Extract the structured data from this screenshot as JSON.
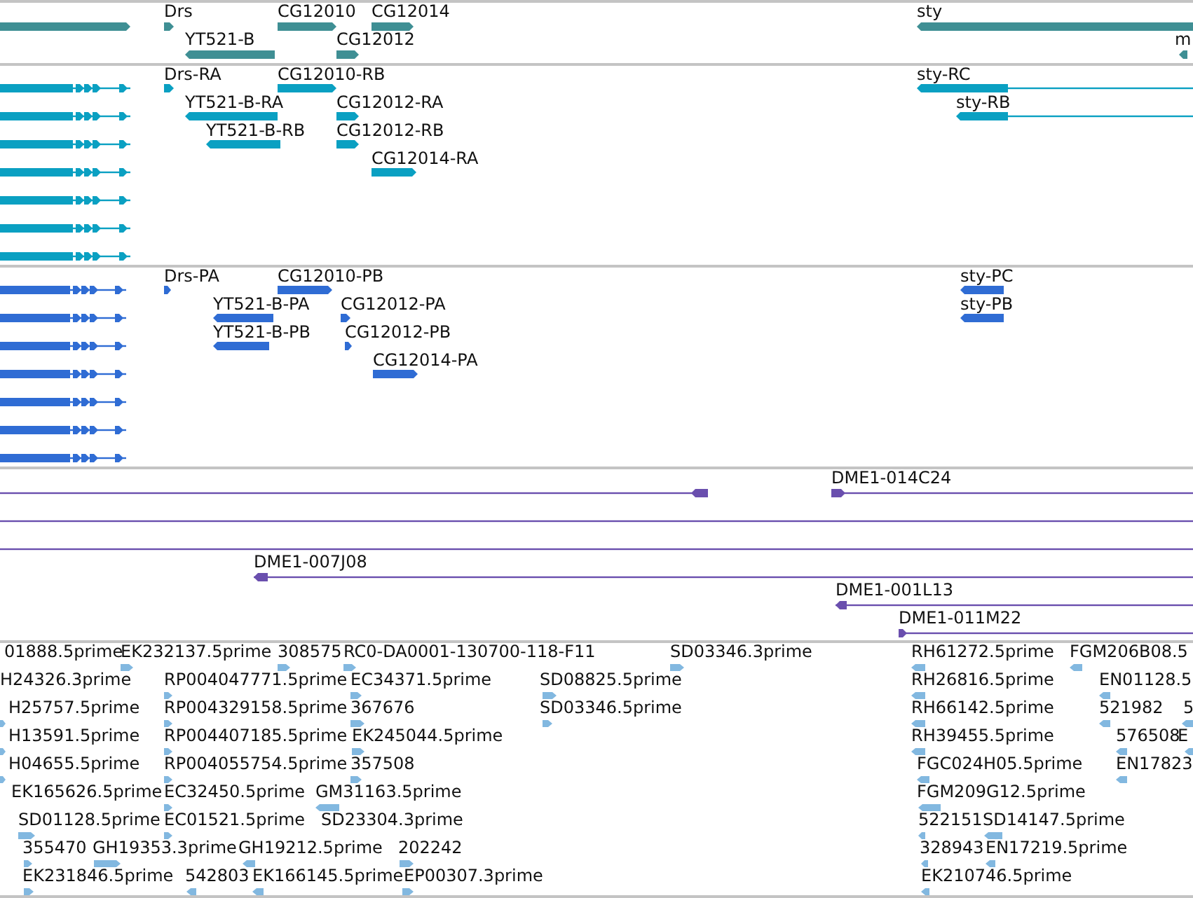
{
  "tracks": [
    {
      "kind": "gene",
      "features": [
        {
          "reverse": false
        },
        {
          "label": "Drs",
          "reverse": false
        },
        {
          "label": "CG12010",
          "reverse": false
        },
        {
          "label": "CG12014",
          "reverse": false
        },
        {
          "label": "sty",
          "reverse": true
        },
        {
          "label": "YT521-B",
          "reverse": true
        },
        {
          "label": "CG12012",
          "reverse": false
        },
        {
          "label": "m",
          "reverse": true
        }
      ]
    },
    {
      "kind": "transcript",
      "features": [
        {
          "reverse": false
        },
        {
          "label": "Drs-RA",
          "reverse": false
        },
        {
          "label": "CG12010-RB",
          "reverse": false
        },
        {
          "label": "sty-RC",
          "reverse": true
        },
        {
          "reverse": false
        },
        {
          "label": "YT521-B-RA",
          "reverse": true
        },
        {
          "label": "CG12012-RA",
          "reverse": false
        },
        {
          "label": "sty-RB",
          "reverse": true
        },
        {
          "reverse": false
        },
        {
          "label": "YT521-B-RB",
          "reverse": true
        },
        {
          "label": "CG12012-RB",
          "reverse": false
        },
        {
          "reverse": false
        },
        {
          "label": "CG12014-RA",
          "reverse": false
        },
        {
          "reverse": false
        },
        {
          "reverse": false
        },
        {
          "reverse": false
        }
      ]
    },
    {
      "kind": "protein",
      "features": [
        {
          "reverse": false
        },
        {
          "label": "Drs-PA",
          "reverse": false
        },
        {
          "label": "CG12010-PB",
          "reverse": false
        },
        {
          "label": "sty-PC",
          "reverse": true
        },
        {
          "reverse": false
        },
        {
          "label": "YT521-B-PA",
          "reverse": true
        },
        {
          "label": "CG12012-PA",
          "reverse": false
        },
        {
          "label": "sty-PB",
          "reverse": true
        },
        {
          "reverse": false
        },
        {
          "label": "YT521-B-PB",
          "reverse": true
        },
        {
          "label": "CG12012-PB",
          "reverse": false
        },
        {
          "reverse": false
        },
        {
          "label": "CG12014-PA",
          "reverse": false
        },
        {
          "reverse": false
        },
        {
          "reverse": false
        },
        {
          "reverse": false
        }
      ]
    },
    {
      "kind": "clone",
      "features": [
        {
          "reverse": true
        },
        {
          "label": "DME1-014C24",
          "reverse": false
        },
        {
          "kind": "line"
        },
        {
          "kind": "line"
        },
        {
          "label": "DME1-007J08",
          "reverse": true
        },
        {
          "label": "DME1-001L13",
          "reverse": true
        },
        {
          "label": "DME1-011M22",
          "reverse": false
        }
      ]
    },
    {
      "kind": "est",
      "features": [
        {
          "label": "01888.5prime"
        },
        {
          "label": "EK232137.5prime",
          "reverse": false
        },
        {
          "label": "308575",
          "reverse": false
        },
        {
          "label": "RC0-DA0001-130700-118-F11",
          "reverse": false
        },
        {
          "label": "SD03346.3prime",
          "reverse": false
        },
        {
          "label": "RH61272.5prime",
          "reverse": true
        },
        {
          "label": "FGM206B08.5",
          "reverse": true
        },
        {
          "label": "H24326.3prime"
        },
        {
          "label": "RP004047771.5prime",
          "reverse": false
        },
        {
          "label": "EC34371.5prime",
          "reverse": false
        },
        {
          "label": "SD08825.5prime",
          "reverse": false
        },
        {
          "label": "RH26816.5prime",
          "reverse": true
        },
        {
          "label": "EN01128.5",
          "reverse": true
        },
        {
          "label": "H25757.5prime",
          "reverse": false
        },
        {
          "label": "RP004329158.5prime",
          "reverse": false
        },
        {
          "label": "367676",
          "reverse": false
        },
        {
          "label": "SD03346.5prime",
          "reverse": false
        },
        {
          "label": "RH66142.5prime",
          "reverse": true
        },
        {
          "label": "521982",
          "reverse": true
        },
        {
          "label": "5",
          "reverse": true
        },
        {
          "label": "H13591.5prime",
          "reverse": false
        },
        {
          "label": "RP004407185.5prime",
          "reverse": false
        },
        {
          "label": "EK245044.5prime",
          "reverse": false
        },
        {
          "label": "RH39455.5prime",
          "reverse": true
        },
        {
          "label": "576508",
          "reverse": true
        },
        {
          "label": "E",
          "reverse": true
        },
        {
          "label": "H04655.5prime",
          "reverse": false
        },
        {
          "label": "RP004055754.5prime",
          "reverse": false
        },
        {
          "label": "357508",
          "reverse": false
        },
        {
          "label": "FGC024H05.5prime",
          "reverse": true
        },
        {
          "label": "EN17823",
          "reverse": true
        },
        {
          "label": "EK165626.5prime"
        },
        {
          "label": "EC32450.5prime",
          "reverse": false
        },
        {
          "label": "GM31163.5prime",
          "reverse": true
        },
        {
          "label": "FGM209G12.5prime",
          "reverse": true
        },
        {
          "label": "SD01128.5prime",
          "reverse": false
        },
        {
          "label": "EC01521.5prime",
          "reverse": false
        },
        {
          "label": "SD23304.3prime"
        },
        {
          "label": "522151",
          "reverse": true
        },
        {
          "label": "SD14147.5prime",
          "reverse": true
        },
        {
          "label": "355470",
          "reverse": false
        },
        {
          "label": "GH19353.3prime",
          "reverse": false
        },
        {
          "label": "GH19212.5prime",
          "reverse": true
        },
        {
          "label": "202242",
          "reverse": false
        },
        {
          "label": "328943",
          "reverse": true
        },
        {
          "label": "EN17219.5prime",
          "reverse": true
        },
        {
          "label": "EK231846.5prime",
          "reverse": false
        },
        {
          "label": "542803",
          "reverse": true
        },
        {
          "label": "EK166145.5prime",
          "reverse": true
        },
        {
          "label": "EP00307.3prime",
          "reverse": false
        },
        {
          "label": "EK210746.5prime",
          "reverse": true
        }
      ]
    }
  ]
}
